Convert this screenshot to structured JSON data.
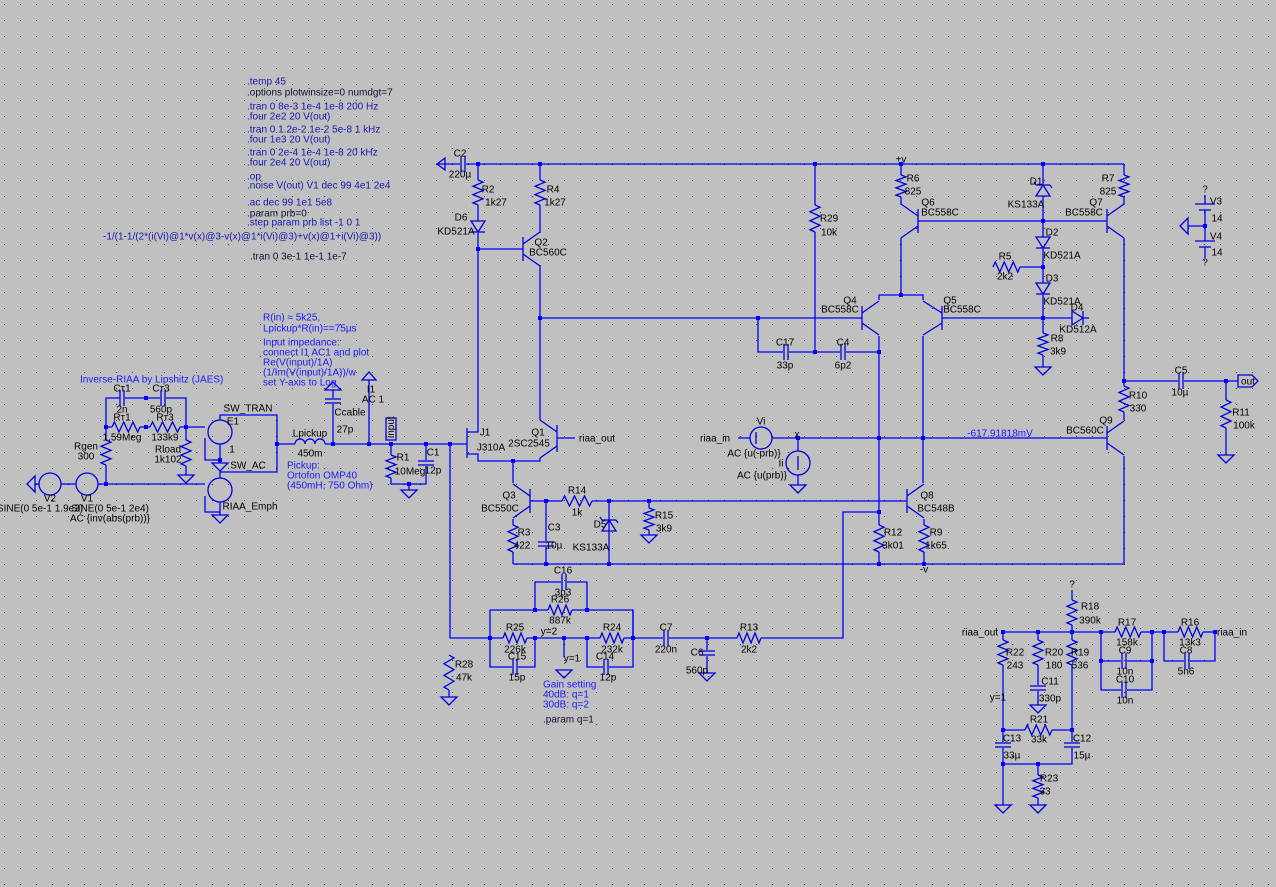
{
  "colors": {
    "background": "#c0c0c0",
    "wire": "#0000ff",
    "grid_dot": "#000000",
    "directive": "#1818b0",
    "label": "#000000"
  },
  "directives": [
    ".temp 45",
    ".options plotwinsize=0 numdgt=7",
    ".tran 0 8e-3 1e-4 1e-8   200 Hz",
    ".four 2e2 20 V(out)",
    ".tran 0 1.2e-2 1e-2 5e-8 1 kHz",
    ".four 1e3 20 V(out)",
    ".tran 0 2e-4 1e-4 1e-8   20 kHz",
    ".four 2e4 20 V(out)",
    ".op",
    ".noise V(out) V1 dec 99 4e1 2e4",
    ".ac dec 99 1e1 5e8",
    ".param prb=0",
    ".step param prb list -1 0 1",
    "-1/(1-1/(2*(i(Vi)@1*v(x)@3-v(x)@1*i(Vi)@3)+v(x)@1+i(Vi)@3))",
    ".tran 0 3e-1 1e-1 1e-7",
    ".param q=1"
  ],
  "comments": {
    "inverse_riaa": "Inverse-RIAA by Lipshitz (JAES)",
    "rin": [
      "R(in) ≈ 5k25,",
      "Lpickup*R(in)==75µs"
    ],
    "input_impedance": [
      "Input impedance:",
      "connect I1 AC1 and plot",
      "Re(V(input)/1A)",
      "(1/Im(V(input)/1A))/w",
      "set Y-axis to Log"
    ],
    "pickup": [
      "Pickup:",
      "Ortofon OMP40",
      "(450mH, 750 Ohm)"
    ],
    "gain": [
      "Gain setting",
      "40dB: q=1",
      "30dB: q=2"
    ]
  },
  "readout": "-617.91818mV",
  "net_labels": {
    "riaa_out_1": "riaa_out",
    "riaa_in_1": "riaa_in",
    "riaa_out_2": "riaa_out",
    "riaa_in_2": "riaa_in",
    "out": "out",
    "input": "input",
    "x": "x",
    "pos_v": "+v",
    "neg_v": "-v",
    "sw_tran": "SW_TRAN",
    "sw_ac": "SW_AC",
    "y2": "y=2",
    "y1": "y=1",
    "y1b": "y=1",
    "q_v3": "?",
    "q_v4": "?",
    "q_r18": "?"
  },
  "components": {
    "Ct1": {
      "ref": "Cт1",
      "value": "2n"
    },
    "Ct3": {
      "ref": "Cт3",
      "value": "560p"
    },
    "Rt1": {
      "ref": "Rт1",
      "value": "1.59Meg"
    },
    "Rt3": {
      "ref": "Rт3",
      "value": "133k9"
    },
    "Rgen": {
      "ref": "Rgen",
      "value": "300"
    },
    "Rload": {
      "ref": "Rload",
      "value": "1k102"
    },
    "E1": {
      "ref": "E1",
      "value": "1"
    },
    "RIAA_Emph": {
      "ref": "RIAA_Emph"
    },
    "V2": {
      "ref": "V2",
      "value": "SINE(0 5e-1 1.9e3)"
    },
    "V1": {
      "ref": "V1",
      "value": "SINE(0 5e-1 2e4)",
      "ac": "AC {inv(abs(prb))}"
    },
    "Lpickup": {
      "ref": "Lpickup",
      "value": "450m"
    },
    "Ccable": {
      "ref": "Ccable",
      "value": "27p"
    },
    "I1": {
      "ref": "I1",
      "value": "AC 1"
    },
    "R1": {
      "ref": "R1",
      "value": "10Meg"
    },
    "C1": {
      "ref": "C1",
      "value": "12p"
    },
    "C2": {
      "ref": "C2",
      "value": "220µ"
    },
    "R2": {
      "ref": "R2",
      "value": "1k27"
    },
    "R4": {
      "ref": "R4",
      "value": "1k27"
    },
    "D6": {
      "ref": "D6",
      "value": "KD521A"
    },
    "Q2": {
      "ref": "Q2",
      "value": "BC560C"
    },
    "R29": {
      "ref": "R29",
      "value": "10k"
    },
    "C17": {
      "ref": "C17",
      "value": "33p"
    },
    "C4": {
      "ref": "C4",
      "value": "6p2"
    },
    "Q4": {
      "ref": "Q4",
      "value": "BC558C"
    },
    "Q5": {
      "ref": "Q5",
      "value": "BC558C"
    },
    "J1": {
      "ref": "J1",
      "value": "J310A"
    },
    "Q1": {
      "ref": "Q1",
      "value": "2SC2545"
    },
    "Vi": {
      "ref": "Vi",
      "value": "AC {u(-prb)}"
    },
    "Ii": {
      "ref": "Ii",
      "value": "AC {u(prb)}"
    },
    "Q3": {
      "ref": "Q3",
      "value": "BC550C"
    },
    "R14": {
      "ref": "R14",
      "value": "1k"
    },
    "R15": {
      "ref": "R15",
      "value": "3k9"
    },
    "D5": {
      "ref": "D5",
      "value": "KS133A"
    },
    "R3": {
      "ref": "R3",
      "value": "422"
    },
    "C3": {
      "ref": "C3",
      "value": "10µ"
    },
    "Q8": {
      "ref": "Q8",
      "value": "BC548B"
    },
    "R12": {
      "ref": "R12",
      "value": "3k01"
    },
    "R9": {
      "ref": "R9",
      "value": "1k65"
    },
    "C16": {
      "ref": "C16",
      "value": "3p3"
    },
    "R26": {
      "ref": "R26",
      "value": "887k"
    },
    "R25": {
      "ref": "R25",
      "value": "226k"
    },
    "C15": {
      "ref": "C15",
      "value": "15p"
    },
    "R24": {
      "ref": "R24",
      "value": "232k"
    },
    "C14": {
      "ref": "C14",
      "value": "12p"
    },
    "C7": {
      "ref": "C7",
      "value": "220n"
    },
    "C6": {
      "ref": "C6",
      "value": "560p"
    },
    "R13": {
      "ref": "R13",
      "value": "2k2"
    },
    "R28": {
      "ref": "R28",
      "value": "47k"
    },
    "R6": {
      "ref": "R6",
      "value": "825"
    },
    "Q6": {
      "ref": "Q6",
      "value": "BC558C"
    },
    "D1": {
      "ref": "D1",
      "value": "KS133A"
    },
    "R7": {
      "ref": "R7",
      "value": "825"
    },
    "Q7": {
      "ref": "Q7",
      "value": "BC558C"
    },
    "D2": {
      "ref": "D2",
      "value": "KD521A"
    },
    "R5": {
      "ref": "R5",
      "value": "2k2"
    },
    "D3": {
      "ref": "D3",
      "value": "KD521A"
    },
    "D4": {
      "ref": "D4",
      "value": "KD512A"
    },
    "R8": {
      "ref": "R8",
      "value": "3k9"
    },
    "V3": {
      "ref": "V3",
      "value": "14"
    },
    "V4": {
      "ref": "V4",
      "value": "14"
    },
    "C5": {
      "ref": "C5",
      "value": "10µ"
    },
    "R10": {
      "ref": "R10",
      "value": "330"
    },
    "R11": {
      "ref": "R11",
      "value": "100k"
    },
    "Q9": {
      "ref": "Q9",
      "value": "BC560C"
    },
    "R18": {
      "ref": "R18",
      "value": "390k"
    },
    "R17": {
      "ref": "R17",
      "value": "158k"
    },
    "R16": {
      "ref": "R16",
      "value": "13k3"
    },
    "R22": {
      "ref": "R22",
      "value": "243"
    },
    "R20": {
      "ref": "R20",
      "value": "180"
    },
    "R19": {
      "ref": "R19",
      "value": "536"
    },
    "C9": {
      "ref": "C9",
      "value": "10n"
    },
    "C10": {
      "ref": "C10",
      "value": "10n"
    },
    "C8": {
      "ref": "C8",
      "value": "5n6"
    },
    "C11": {
      "ref": "C11",
      "value": "330p"
    },
    "R21": {
      "ref": "R21",
      "value": "33k"
    },
    "C13": {
      "ref": "C13",
      "value": "33µ"
    },
    "C12": {
      "ref": "C12",
      "value": "15µ"
    },
    "R23": {
      "ref": "R23",
      "value": "33"
    }
  }
}
